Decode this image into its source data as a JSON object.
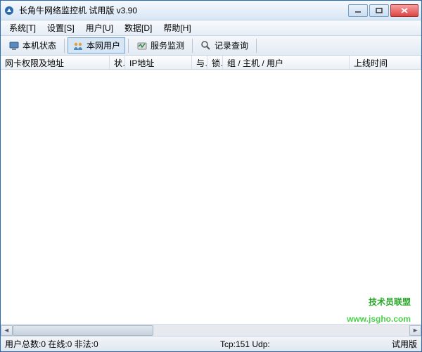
{
  "titlebar": {
    "title": "长角牛网络监控机 试用版 v3.90"
  },
  "menu": {
    "system": "系统[T]",
    "settings": "设置[S]",
    "user": "用户[U]",
    "data": "数据[D]",
    "help": "帮助[H]"
  },
  "toolbar": {
    "localStatus": "本机状态",
    "netUsers": "本网用户",
    "serviceMonitor": "服务监测",
    "logQuery": "记录查询"
  },
  "columns": {
    "col1": "网卡权限及地址",
    "col2": "状",
    "col3": "IP地址",
    "col4": "与",
    "col5": "锁",
    "col6": "组 / 主机 / 用户",
    "col7": "上线时间"
  },
  "status": {
    "left": "用户总数:0 在线:0 非法:0",
    "right": "Tcp:151 Udp:         ",
    "trial": "试用版"
  },
  "watermark": {
    "line1": "技术员联盟",
    "line2": "www.jsgho.com"
  }
}
